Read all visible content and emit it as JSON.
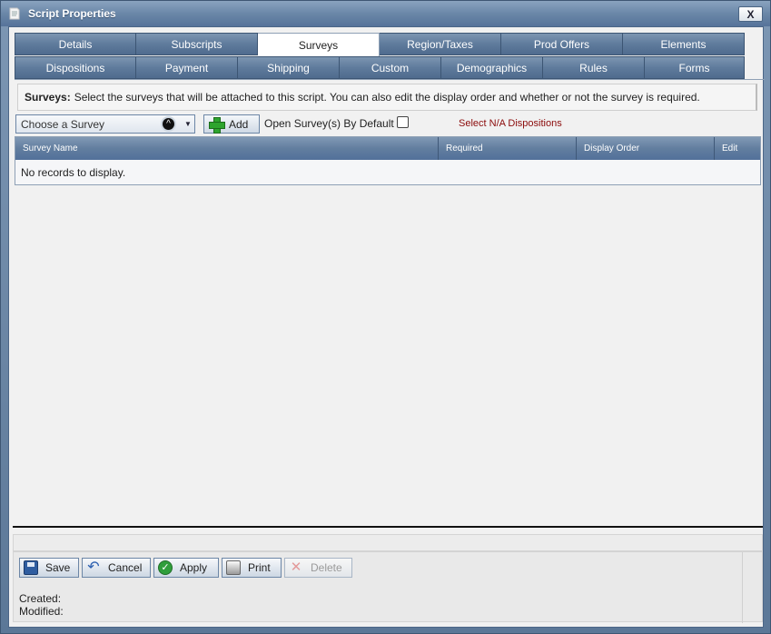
{
  "window": {
    "title": "Script Properties",
    "close_label": "X"
  },
  "tabs": {
    "row1": [
      "Details",
      "Subscripts",
      "Surveys",
      "Region/Taxes",
      "Prod Offers",
      "Elements"
    ],
    "row2": [
      "Dispositions",
      "Payment",
      "Shipping",
      "Custom",
      "Demographics",
      "Rules",
      "Forms"
    ],
    "active": "Surveys"
  },
  "description": {
    "label": "Surveys:",
    "text": "Select the surveys that will be attached to this script. You can also edit the display order and whether or not the survey is required."
  },
  "toolbar": {
    "survey_select_value": "Choose a Survey",
    "add_label": "Add",
    "open_default_label": "Open Survey(s) By Default",
    "open_default_checked": false,
    "na_dispositions_label": "Select N/A Dispositions"
  },
  "grid": {
    "columns": [
      "Survey Name",
      "Required",
      "Display Order",
      "Edit"
    ],
    "empty_message": "No records to display."
  },
  "footer": {
    "buttons": {
      "save": "Save",
      "cancel": "Cancel",
      "apply": "Apply",
      "print": "Print",
      "delete": "Delete"
    },
    "created_label": "Created:",
    "modified_label": "Modified:"
  }
}
